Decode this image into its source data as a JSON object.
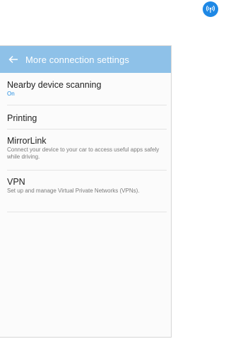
{
  "status_icon": {
    "name": "wireless-signal-icon",
    "color": "#1e88e5"
  },
  "appbar": {
    "back_icon": "back-arrow-icon",
    "title": "More connection settings",
    "color": "#8ec1e8"
  },
  "items": [
    {
      "title": "Nearby device scanning",
      "status": "On"
    },
    {
      "title": "Printing"
    },
    {
      "title": "MirrorLink",
      "description": "Connect your device to your car to access useful apps safely while driving."
    },
    {
      "title": "VPN",
      "description": "Set up and manage Virtual Private Networks (VPNs)."
    }
  ],
  "accent_color": "#1f8be0"
}
